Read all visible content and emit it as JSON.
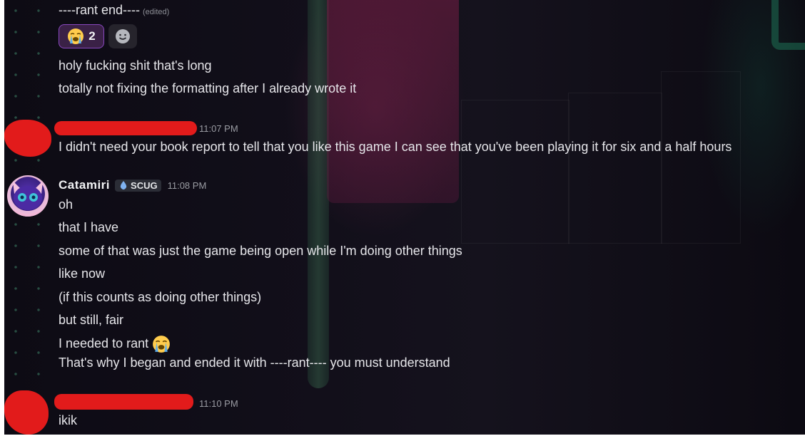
{
  "messages": {
    "rant_end": {
      "text": "----rant end----",
      "edited": "(edited)"
    },
    "reactions": [
      {
        "icon": "loudly-crying-face-emoji",
        "count": "2"
      }
    ],
    "add_reaction_icon": "smiley-add-reaction-icon",
    "line_long": "holy fucking shit that's long",
    "line_format": "totally not fixing the formatting after I already wrote it",
    "reply1": {
      "timestamp": "11:07 PM",
      "text": "I didn't need your book report to tell that you like this game I can see that you've been playing it for six and a half hours"
    },
    "catamiri": {
      "username": "Catamiri",
      "tag": "SCUG",
      "timestamp": "11:08 PM",
      "lines": [
        "oh",
        "that I have",
        "some of that was just the game being open while I'm doing other things",
        "like now",
        "(if this counts as doing other things)",
        "but still, fair",
        "I needed to rant",
        "That's why I began and ended it with ----rant---- you must understand"
      ]
    },
    "reply2": {
      "timestamp": "11:10 PM",
      "text": "ikik"
    }
  },
  "colors": {
    "accent_reaction": "#8a48c0",
    "redaction": "#e21b1b"
  }
}
